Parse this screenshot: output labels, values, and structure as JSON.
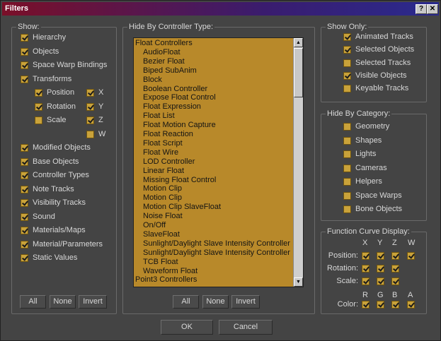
{
  "window": {
    "title": "Filters",
    "help_glyph": "?",
    "close_glyph": "✕"
  },
  "show": {
    "title": "Show:",
    "items": [
      {
        "label": "Hierarchy",
        "checked": true
      },
      {
        "label": "Objects",
        "checked": true
      },
      {
        "label": "Space Warp Bindings",
        "checked": true
      },
      {
        "label": "Transforms",
        "checked": true
      }
    ],
    "transforms": [
      {
        "label": "Position",
        "checked": true
      },
      {
        "label": "Rotation",
        "checked": true
      },
      {
        "label": "Scale",
        "checked": false
      }
    ],
    "axes": [
      {
        "label": "X",
        "checked": true
      },
      {
        "label": "Y",
        "checked": true
      },
      {
        "label": "Z",
        "checked": true
      },
      {
        "label": "W",
        "checked": false
      }
    ],
    "items2": [
      {
        "label": "Modified Objects",
        "checked": true
      },
      {
        "label": "Base Objects",
        "checked": true
      },
      {
        "label": "Controller Types",
        "checked": true
      },
      {
        "label": "Note Tracks",
        "checked": true
      },
      {
        "label": "Visibility Tracks",
        "checked": true
      },
      {
        "label": "Sound",
        "checked": true
      },
      {
        "label": "Materials/Maps",
        "checked": true
      },
      {
        "label": "Material/Parameters",
        "checked": true
      },
      {
        "label": "Static Values",
        "checked": true
      }
    ],
    "buttons": {
      "all": "All",
      "none": "None",
      "invert": "Invert"
    }
  },
  "hide_by_controller": {
    "title": "Hide By Controller Type:",
    "items": [
      {
        "label": "Float Controllers",
        "indent": false
      },
      {
        "label": "AudioFloat",
        "indent": true
      },
      {
        "label": "Bezier Float",
        "indent": true
      },
      {
        "label": "Biped SubAnim",
        "indent": true
      },
      {
        "label": "Block",
        "indent": true
      },
      {
        "label": "Boolean Controller",
        "indent": true
      },
      {
        "label": "Expose Float Control",
        "indent": true
      },
      {
        "label": "Float Expression",
        "indent": true
      },
      {
        "label": "Float List",
        "indent": true
      },
      {
        "label": "Float Motion Capture",
        "indent": true
      },
      {
        "label": "Float Reaction",
        "indent": true
      },
      {
        "label": "Float Script",
        "indent": true
      },
      {
        "label": "Float Wire",
        "indent": true
      },
      {
        "label": "LOD Controller",
        "indent": true
      },
      {
        "label": "Linear Float",
        "indent": true
      },
      {
        "label": "Missing Float Control",
        "indent": true
      },
      {
        "label": "Motion Clip",
        "indent": true
      },
      {
        "label": "Motion Clip",
        "indent": true
      },
      {
        "label": "Motion Clip SlaveFloat",
        "indent": true
      },
      {
        "label": "Noise Float",
        "indent": true
      },
      {
        "label": "On/Off",
        "indent": true
      },
      {
        "label": "SlaveFloat",
        "indent": true
      },
      {
        "label": "Sunlight/Daylight Slave Intensity Controller",
        "indent": true
      },
      {
        "label": "Sunlight/Daylight Slave Intensity Controller",
        "indent": true
      },
      {
        "label": "TCB Float",
        "indent": true
      },
      {
        "label": "Waveform Float",
        "indent": true
      },
      {
        "label": "Point3 Controllers",
        "indent": false
      }
    ],
    "buttons": {
      "all": "All",
      "none": "None",
      "invert": "Invert"
    }
  },
  "show_only": {
    "title": "Show Only:",
    "items": [
      {
        "label": "Animated Tracks",
        "checked": true
      },
      {
        "label": "Selected Objects",
        "checked": true
      },
      {
        "label": "Selected Tracks",
        "checked": false
      },
      {
        "label": "Visible Objects",
        "checked": true
      },
      {
        "label": "Keyable Tracks",
        "checked": false
      }
    ]
  },
  "hide_by_category": {
    "title": "Hide By Category:",
    "items": [
      {
        "label": "Geometry",
        "checked": false
      },
      {
        "label": "Shapes",
        "checked": false
      },
      {
        "label": "Lights",
        "checked": false
      },
      {
        "label": "Cameras",
        "checked": false
      },
      {
        "label": "Helpers",
        "checked": false
      },
      {
        "label": "Space Warps",
        "checked": false
      },
      {
        "label": "Bone Objects",
        "checked": false
      }
    ]
  },
  "function_curve": {
    "title": "Function Curve Display:",
    "axis_headers": [
      "X",
      "Y",
      "Z",
      "W"
    ],
    "rows": [
      {
        "label": "Position:",
        "checks": [
          true,
          true,
          true,
          true
        ]
      },
      {
        "label": "Rotation:",
        "checks": [
          true,
          true,
          true
        ]
      },
      {
        "label": "Scale:",
        "checks": [
          true,
          true,
          true
        ]
      }
    ],
    "color_headers": [
      "R",
      "G",
      "B",
      "A"
    ],
    "color_label": "Color:",
    "color_checks": [
      true,
      true,
      true,
      true
    ]
  },
  "dialog_buttons": {
    "ok": "OK",
    "cancel": "Cancel"
  }
}
